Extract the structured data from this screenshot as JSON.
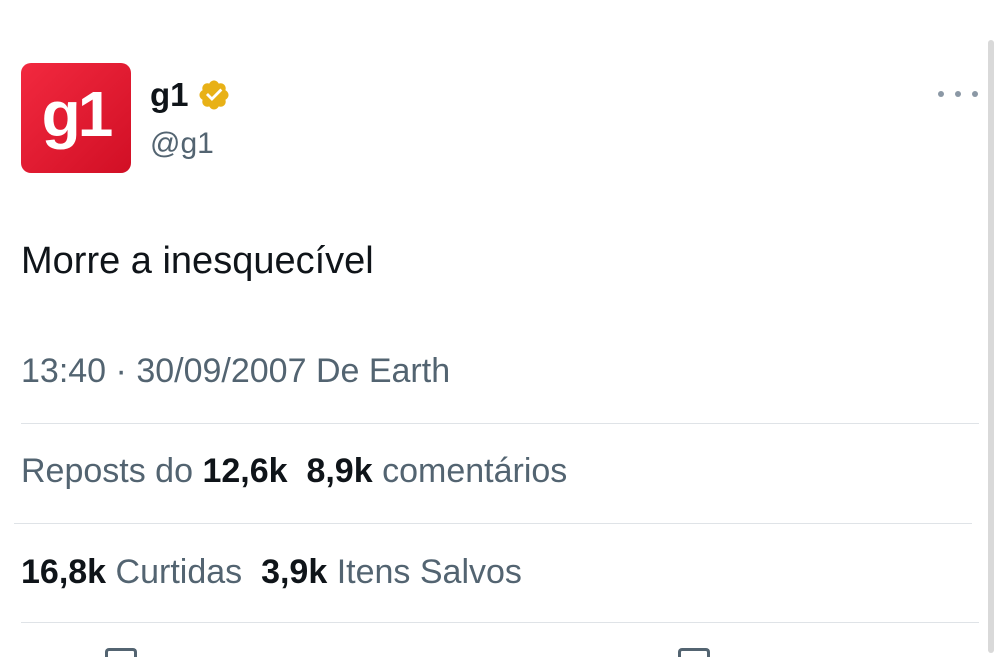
{
  "author": {
    "avatar_text": "g1",
    "display_name": "g1",
    "handle": "@g1"
  },
  "tweet": {
    "text": "Morre a inesquecível",
    "time": "13:40",
    "separator": "·",
    "date_source": "30/09/2007 De Earth"
  },
  "stats": {
    "reposts_label": "Reposts do",
    "reposts_count": "12,6k",
    "comments_count": "8,9k",
    "comments_label": "comentários",
    "likes_count": "16,8k",
    "likes_label": "Curtidas",
    "saves_count": "3,9k",
    "saves_label": "Itens Salvos"
  },
  "icons": {
    "verified": "verified-badge-icon",
    "more": "more-options-icon"
  },
  "colors": {
    "brand": "#e3172f",
    "verified": "#e8b117",
    "text_primary": "#0f1419",
    "text_secondary": "#536471"
  }
}
